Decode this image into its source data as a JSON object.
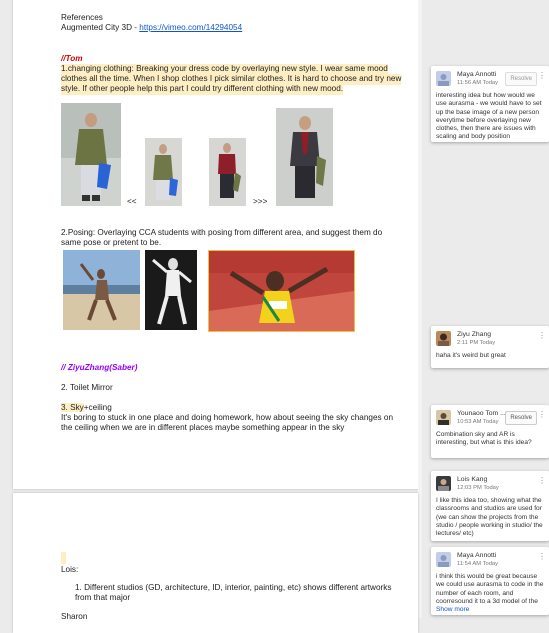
{
  "doc": {
    "references_title": "References",
    "references_line_prefix": "Augmented City 3D - ",
    "references_link": "https://vimeo.com/14294054",
    "author1": "//Tom",
    "section1_lines": [
      "1.changing clothing: Breaking your dress code by overlaying new style. I wear same mood",
      "clothes all the time. When I shop clothes I pick similar clothes. It is hard to choose and try new",
      "style. If other people help this part I could try different clothing with new mood."
    ],
    "arrow_left": "<<",
    "arrow_right": ">>>",
    "section2_lines": [
      "2.Posing: Overlaying CCA students with posing from different area, and suggest them do",
      "same pose or pretent to be."
    ],
    "author2": "// ZiyuZhang(Saber)",
    "item_toilet": "2. Toilet Mirror",
    "item_sky_highlight": "3. Sky",
    "item_sky_rest": "+ceiling",
    "sky_lines": [
      "It's boring to stuck in one place and doing homework, how about seeing the sky changes on",
      "the ceiling when we are in different places maybe something appear in the sky"
    ],
    "lois_label": "Lois:",
    "lois_item_lines": [
      "1.    Different studios (GD, architecture, ID, interior, painting, etc) shows different artworks",
      "       from that major"
    ],
    "sharon_label": "Sharon"
  },
  "comments": [
    {
      "author": "Maya Annotti",
      "time": "11:56 AM Today",
      "resolve": "Resolve",
      "text": "interesting idea but how would we use aurasma - we would have to set up the base image of a new person everytime before overlaying new clothes, then there are issues with scaling and body position"
    },
    {
      "author": "Ziyu Zhang",
      "time": "2:11 PM Today",
      "text": "haha it's weird but great"
    },
    {
      "author": "Younaoo Tom ...",
      "time": "10:53 AM Today",
      "resolve": "Resolve",
      "text": "Combination sky and AR is interesting, but what is this idea?"
    },
    {
      "author": "Lois Kang",
      "time": "12:03 PM Today",
      "text": "I like this idea too, showing what the classrooms and studios are used for (we can show the projects from the studio / people working in studio/ the lectures/ etc)"
    },
    {
      "author": "Maya Annotti",
      "time": "11:54 AM Today",
      "text": "i think this would be great because we could use aurasma to code in the number of each room, and coorresound it to a 3d model of the",
      "show_more": "Show more"
    }
  ],
  "colors": {
    "link": "#1155cc",
    "highlight": "#fdefc3",
    "author_tom": "#d50000",
    "author_ziyu": "#9900ff",
    "background": "#ebebeb"
  }
}
